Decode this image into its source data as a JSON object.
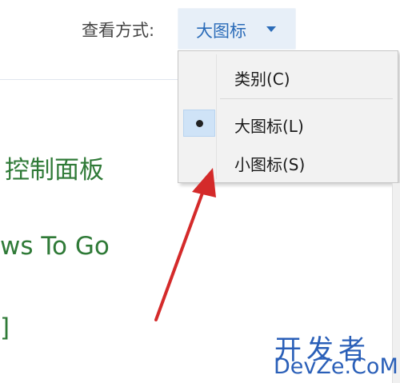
{
  "toolbar": {
    "view_by_label": "查看方式:",
    "view_by_value": "大图标"
  },
  "view_menu": {
    "items": [
      {
        "label": "类别(C)",
        "selected": false
      },
      {
        "label": "大图标(L)",
        "selected": true
      },
      {
        "label": "小图标(S)",
        "selected": false
      }
    ]
  },
  "content": {
    "item_control_panel": "控制面板",
    "item_windows_to_go": "ws To Go",
    "item_partial": "]"
  },
  "watermark": {
    "chinese": "开发者",
    "english": "DevZe.CoM"
  },
  "colors": {
    "accent_blue": "#2a6bb8",
    "link_green": "#2f7a37",
    "annotation_red": "#d42a2a",
    "selected_bg": "#cfe3f7"
  },
  "icons": {
    "dropdown": "chevron-down-icon",
    "selection": "radio-bullet-icon",
    "annotation": "red-arrow-annotation"
  }
}
